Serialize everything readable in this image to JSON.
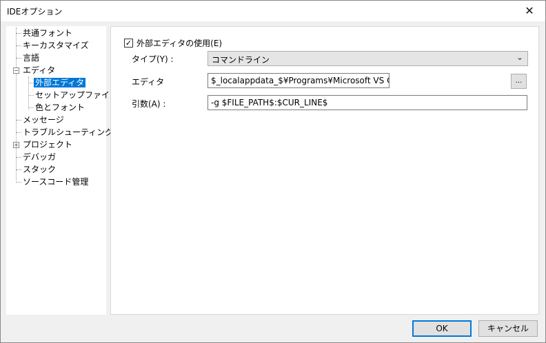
{
  "window": {
    "title": "IDEオプション"
  },
  "tree": {
    "items": [
      {
        "label": "共通フォント"
      },
      {
        "label": "キーカスタマイズ"
      },
      {
        "label": "言語"
      },
      {
        "label": "エディタ",
        "expander": "−"
      },
      {
        "label": "外部エディタ"
      },
      {
        "label": "セットアップファイル"
      },
      {
        "label": "色とフォント"
      },
      {
        "label": "メッセージ"
      },
      {
        "label": "トラブルシューティング"
      },
      {
        "label": "プロジェクト",
        "expander": "+"
      },
      {
        "label": "デバッガ"
      },
      {
        "label": "スタック"
      },
      {
        "label": "ソースコード管理"
      }
    ]
  },
  "external_editor": {
    "use_label": "外部エディタの使用(E)",
    "use_checked_glyph": "✓",
    "type_label": "タイプ(Y) :",
    "type_value": "コマンドライン",
    "editor_label": "エディタ",
    "editor_value": "$_localappdata_$¥Programs¥Microsoft VS Code¥",
    "browse_label": "...",
    "args_label": "引数(A) :",
    "args_value": "-g  $FILE_PATH$:$CUR_LINE$"
  },
  "buttons": {
    "ok": "OK",
    "cancel": "キャンセル"
  }
}
